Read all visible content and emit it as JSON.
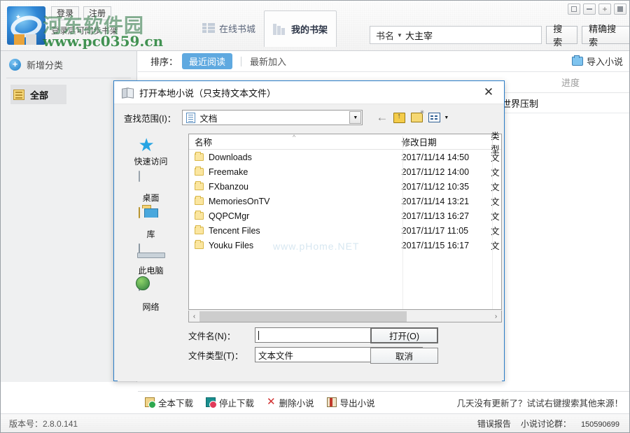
{
  "app": {
    "header": {
      "auth": {
        "login_label": "登录",
        "register_label": "注册",
        "sync_hint": "登录后可同步书架"
      },
      "watermark": {
        "line1": "河东软件园",
        "line2": "www.pc0359.cn"
      },
      "tabs": [
        {
          "label": "在线书城",
          "icon": "grid-icon",
          "active": false
        },
        {
          "label": "我的书架",
          "icon": "books-icon",
          "active": true
        }
      ],
      "search": {
        "scope_label": "书名",
        "scope_caret": "▼",
        "query": "大主宰",
        "placeholder": "",
        "search_label": "搜索",
        "exact_search_label": "精确搜索"
      },
      "window_controls": [
        {
          "name": "menu",
          "glyph": "▤"
        },
        {
          "name": "minimize",
          "glyph": "–"
        },
        {
          "name": "maximize",
          "glyph": "+"
        },
        {
          "name": "close",
          "glyph": "✕"
        }
      ]
    },
    "sidebar": {
      "add_category_label": "新增分类",
      "items": [
        {
          "label": "全部",
          "icon": "list-icon",
          "selected": true
        }
      ]
    },
    "content": {
      "sort": {
        "label": "排序：",
        "options": [
          {
            "label": "最近阅读",
            "active": true
          },
          {
            "label": "最新加入",
            "active": false
          }
        ]
      },
      "import_label": "导入小说",
      "columns": [
        {
          "label": "",
          "key": "name"
        },
        {
          "label": "进度",
          "key": "progress"
        }
      ],
      "rows": [
        {
          "title": "世界压制",
          "progress": ""
        }
      ]
    },
    "bottom_toolbar": {
      "actions": [
        {
          "label": "全本下载",
          "icon": "download-all-icon"
        },
        {
          "label": "停止下载",
          "icon": "stop-download-icon"
        },
        {
          "label": "删除小说",
          "icon": "delete-icon"
        },
        {
          "label": "导出小说",
          "icon": "export-icon"
        }
      ],
      "hint": "几天没有更新了？试试右键搜索其他来源！"
    },
    "status_bar": {
      "version_label": "版本号：2.8.0.141",
      "error_report_label": "错误报告",
      "group_label": "小说讨论群：",
      "group_number": "150590699"
    }
  },
  "dialog": {
    "title": "打开本地小说（只支持文本文件）",
    "close_glyph": "✕",
    "look_in": {
      "label": "查找范围(I)：",
      "value": "文档",
      "caret": "▼"
    },
    "toolbar_icons": [
      {
        "name": "back-icon",
        "glyph": "←"
      },
      {
        "name": "up-folder-icon",
        "glyph": ""
      },
      {
        "name": "new-folder-icon",
        "glyph": ""
      },
      {
        "name": "view-mode-icon",
        "glyph": ""
      }
    ],
    "places": [
      {
        "label": "快速访问",
        "icon": "quick-access-star-icon"
      },
      {
        "label": "桌面",
        "icon": "desktop-icon"
      },
      {
        "label": "库",
        "icon": "library-icon"
      },
      {
        "label": "此电脑",
        "icon": "this-pc-icon"
      },
      {
        "label": "网络",
        "icon": "network-icon"
      }
    ],
    "file_list": {
      "columns": [
        "名称",
        "修改日期",
        "类型"
      ],
      "sort_indicator": "^",
      "watermark": "www.pHome.NET",
      "rows": [
        {
          "name": "Downloads",
          "date": "2017/11/14 14:50",
          "type": "文"
        },
        {
          "name": "Freemake",
          "date": "2017/11/12 14:00",
          "type": "文"
        },
        {
          "name": "FXbanzou",
          "date": "2017/11/12 10:35",
          "type": "文"
        },
        {
          "name": "MemoriesOnTV",
          "date": "2017/11/14 13:21",
          "type": "文"
        },
        {
          "name": "QQPCMgr",
          "date": "2017/11/13 16:27",
          "type": "文"
        },
        {
          "name": "Tencent Files",
          "date": "2017/11/17 11:05",
          "type": "文"
        },
        {
          "name": "Youku Files",
          "date": "2017/11/15 16:17",
          "type": "文"
        }
      ]
    },
    "hscroll": {
      "left_arrow": "‹",
      "right_arrow": "›"
    },
    "fields": {
      "file_name_label": "文件名(N)：",
      "file_name_value": "",
      "file_type_label": "文件类型(T)：",
      "file_type_value": "文本文件",
      "caret": "▼"
    },
    "buttons": {
      "open_label": "打开(O)",
      "cancel_label": "取消"
    }
  }
}
